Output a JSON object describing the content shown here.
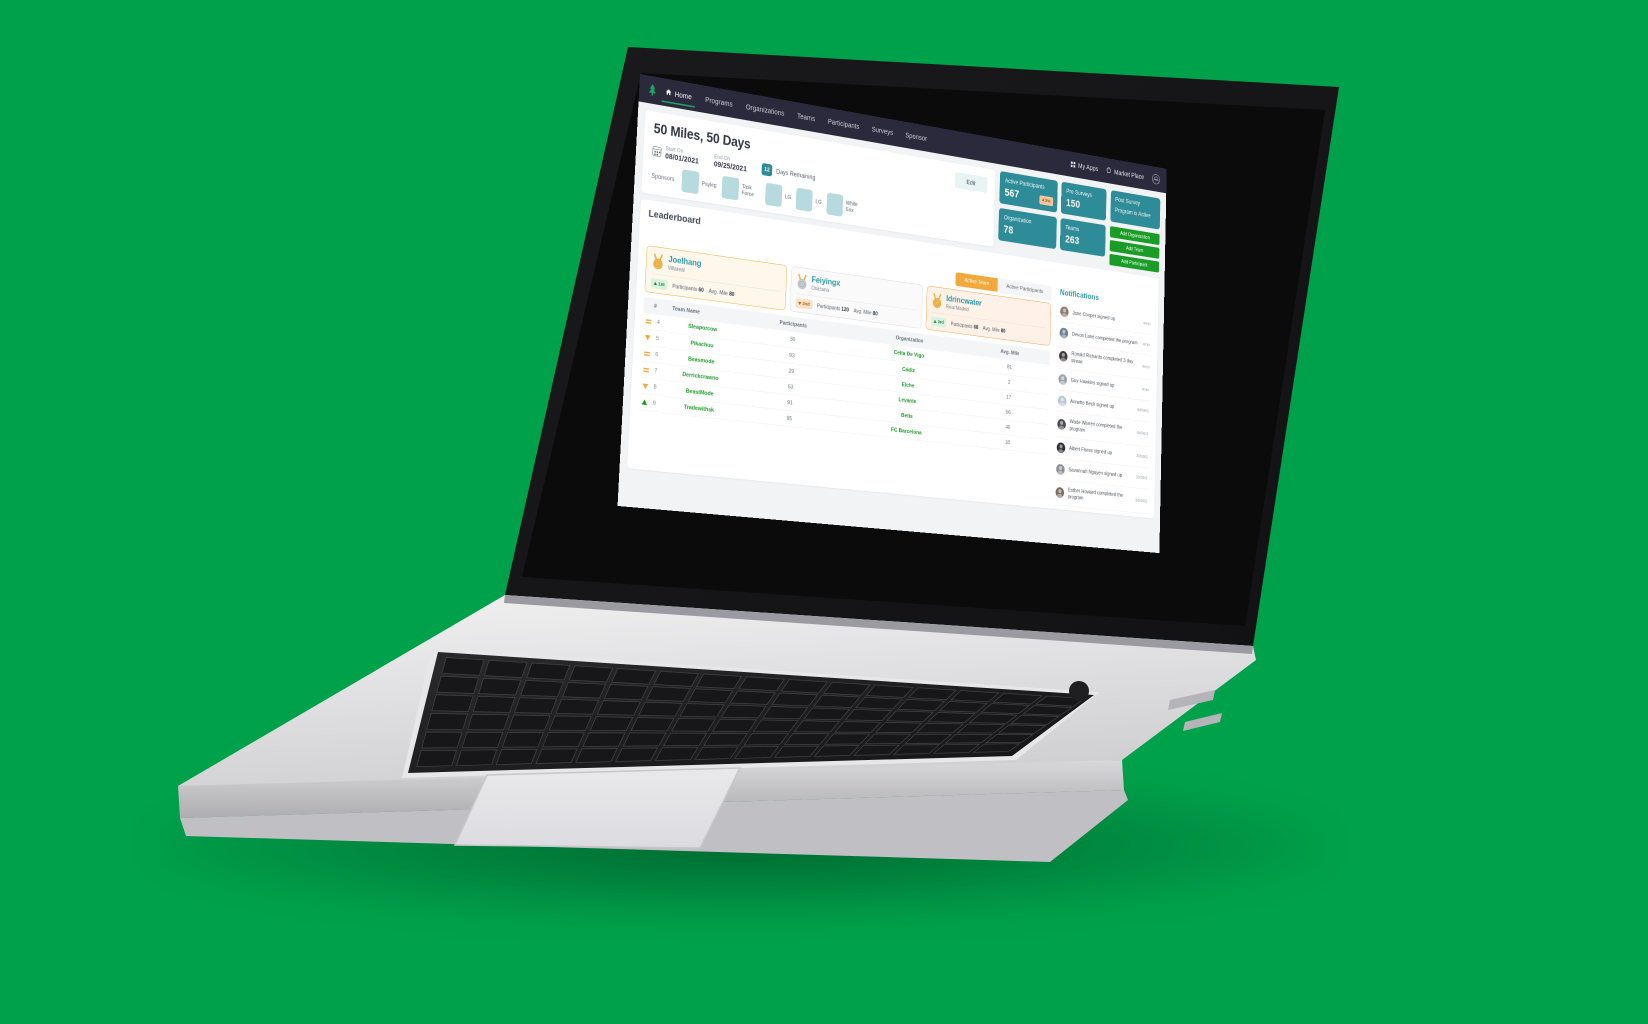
{
  "nav": {
    "logo": "tree-logo-icon",
    "items": [
      {
        "label": "Home",
        "icon": "home-icon",
        "active": true
      },
      {
        "label": "Programs",
        "icon": "",
        "active": false
      },
      {
        "label": "Organizations",
        "icon": "",
        "active": false
      },
      {
        "label": "Teams",
        "icon": "",
        "active": false
      },
      {
        "label": "Participants",
        "icon": "",
        "active": false
      },
      {
        "label": "Surveys",
        "icon": "",
        "active": false
      },
      {
        "label": "Sponsor",
        "icon": "",
        "active": false
      }
    ],
    "right": {
      "my_apps": "My Apps",
      "market_place": "Market Place",
      "account": "account-avatar-icon"
    }
  },
  "program": {
    "title": "50 Miles, 50 Days",
    "edit_label": "Edit",
    "start_label": "Start On",
    "start_value": "08/01/2021",
    "end_label": "End On",
    "end_value": "09/25/2021",
    "days_remaining_count": "12",
    "days_remaining_label": "Days Remaining",
    "sponsors_label": "Sponsors",
    "sponsors": [
      {
        "name": "Psyleg"
      },
      {
        "name": "Task Force"
      },
      {
        "name": "LG"
      },
      {
        "name": "LG"
      },
      {
        "name": "White Sox"
      }
    ]
  },
  "stats": {
    "active_participants": {
      "label": "Active Participants",
      "value": "567",
      "badge": "4 2%"
    },
    "pre_surveys": {
      "label": "Pre Surveys",
      "value": "150"
    },
    "organization": {
      "label": "Organization",
      "value": "78"
    },
    "teams": {
      "label": "Teams",
      "value": "263"
    },
    "post_survey": {
      "label": "Post Survey",
      "value": "Program is Active"
    }
  },
  "actions": {
    "add_organization": "Add Organization",
    "add_team": "Add Team",
    "add_participant": "Add Participant"
  },
  "leaderboard": {
    "title": "Leaderboard",
    "toggle": {
      "active_team": "Active Team",
      "active_participants": "Active Participants",
      "selected": "Active Team"
    },
    "podium": [
      {
        "name": "Joelhang",
        "org": "Villareal",
        "rank_chip": "1st",
        "trend": "up",
        "participants_label": "Participants",
        "participants": "60",
        "avg_label": "Avg. Mile",
        "avg": "80",
        "medal": "gold"
      },
      {
        "name": "Feiyingx",
        "org": "Osasuna",
        "rank_chip": "2nd",
        "trend": "down",
        "participants_label": "Participants",
        "participants": "120",
        "avg_label": "Avg. Mile",
        "avg": "80",
        "medal": "silver"
      },
      {
        "name": "Idrincwater",
        "org": "Real Madrid",
        "rank_chip": "3rd",
        "trend": "up",
        "participants_label": "Participants",
        "participants": "68",
        "avg_label": "Avg. Mile",
        "avg": "80",
        "medal": "bronze"
      }
    ],
    "columns": [
      "#",
      "Team Name",
      "Participants",
      "Organization",
      "Avg. Mile"
    ],
    "rows": [
      {
        "trend": "equal",
        "rank": "4",
        "team": "Sleaporcow",
        "participants": "30",
        "org": "Celta De Vigo",
        "avg": "81"
      },
      {
        "trend": "down",
        "rank": "5",
        "team": "Pikachuu",
        "participants": "93",
        "org": "Cádiz",
        "avg": "2"
      },
      {
        "trend": "equal",
        "rank": "6",
        "team": "Beasmode",
        "participants": "29",
        "org": "Elche",
        "avg": "17"
      },
      {
        "trend": "equal",
        "rank": "7",
        "team": "Derrickcrawno",
        "participants": "53",
        "org": "Levante",
        "avg": "56"
      },
      {
        "trend": "down",
        "rank": "8",
        "team": "BeastMode",
        "participants": "91",
        "org": "Betis",
        "avg": "40"
      },
      {
        "trend": "up",
        "rank": "9",
        "team": "Tradewithsk",
        "participants": "95",
        "org": "FC Barcelona",
        "avg": "18"
      }
    ]
  },
  "notifications": {
    "title": "Notifications",
    "items": [
      {
        "text": "Jane Cooper signed up",
        "time": "4min"
      },
      {
        "text": "Devon Lane completed the program",
        "time": "4min"
      },
      {
        "text": "Ronald Richards completed 3 day streak",
        "time": "4min"
      },
      {
        "text": "Guy Hawkins signed up",
        "time": "4min"
      },
      {
        "text": "Annette Beck signed up",
        "time": "04/06/2"
      },
      {
        "text": "Wade Warren completed the program",
        "time": "04/06/2"
      },
      {
        "text": "Albert Flores signed up",
        "time": "30/09/2"
      },
      {
        "text": "Savannah Nguyen signed up",
        "time": "30/09/2"
      },
      {
        "text": "Esther Howard completed the program",
        "time": "30/09/2"
      }
    ]
  },
  "colors": {
    "teal": "#2e8b98",
    "green": "#1a9d26",
    "orange": "#f0a93a",
    "navy": "#2b2a3d",
    "background": "#00A14B"
  }
}
